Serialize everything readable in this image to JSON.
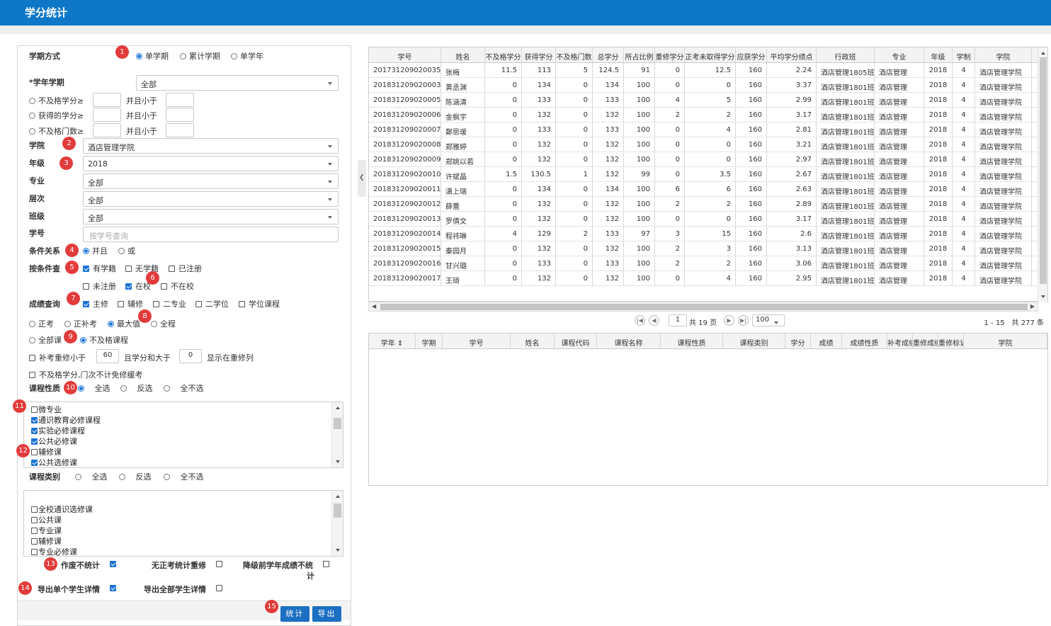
{
  "header": {
    "title": "学分统计"
  },
  "form": {
    "term_mode": {
      "label": "学期方式",
      "options": [
        "单学期",
        "累计学期",
        "单学年"
      ],
      "selected": 0
    },
    "term": {
      "label": "*学年学期",
      "value": "全部"
    },
    "fail_credit": {
      "label": "不及格学分≥",
      "and_less": "并且小于"
    },
    "earned_credit": {
      "label": "获得的学分≥",
      "and_less": "并且小于"
    },
    "fail_courses": {
      "label": "不及格门数≥",
      "and_less": "并且小于"
    },
    "college": {
      "label": "学院",
      "value": "酒店管理学院"
    },
    "grade": {
      "label": "年级",
      "value": "2018"
    },
    "major": {
      "label": "专业",
      "value": "全部"
    },
    "level": {
      "label": "层次",
      "value": "全部"
    },
    "class": {
      "label": "班级",
      "value": "全部"
    },
    "student_id": {
      "label": "学号",
      "placeholder": "按学号查询"
    },
    "condition": {
      "label": "条件关系",
      "options": [
        "并且",
        "或"
      ],
      "selected": 0
    },
    "filter": {
      "label": "按条件查",
      "options": [
        "有学籍",
        "无学籍",
        "已注册",
        "未注册",
        "在校",
        "不在校"
      ]
    },
    "score_query": {
      "label": "成绩查询",
      "options": [
        "主修",
        "辅修",
        "二专业",
        "二学位",
        "学位课程"
      ]
    },
    "exam_types": [
      "正考",
      "正补考",
      "最大值",
      "全程"
    ],
    "course_scope": [
      "全部课",
      "不及格课程"
    ],
    "retake": {
      "text1": "补考重修小于",
      "v1": "60",
      "text2": "且学分和大于",
      "v2": "0",
      "text3": "显示在重修列"
    },
    "exclude": "不及格学分,门次不计免修缓考",
    "course_nature": {
      "label": "课程性质",
      "options": [
        "全选",
        "反选",
        "全不选"
      ],
      "items": [
        "微专业",
        "通识教育必修课程",
        "实验必修课程",
        "公共必修课",
        "辅修课",
        "公共选修课"
      ]
    },
    "course_category": {
      "label": "课程类别",
      "options": [
        "全选",
        "反选",
        "全不选"
      ],
      "items": [
        "全校通识选修课",
        "公共课",
        "专业课",
        "辅修课",
        "专业必修课"
      ]
    },
    "opts": {
      "void_label": "作废不统计",
      "no_exam_label": "无正考统计重修",
      "downgrade_label_1": "降级前学年成绩不统",
      "downgrade_label_2": "计",
      "export_one": "导出单个学生详情",
      "export_all": "导出全部学生详情"
    },
    "buttons": {
      "stat": "统计",
      "export": "导出"
    }
  },
  "badges": [
    "1",
    "2",
    "3",
    "4",
    "5",
    "6",
    "7",
    "8",
    "9",
    "10",
    "11",
    "12",
    "13",
    "14",
    "15"
  ],
  "grid": {
    "columns": [
      "学号",
      "姓名",
      "不及格学分",
      "获得学分",
      "不及格门数",
      "总学分",
      "所占比例",
      "重修学分",
      "正考未取得学分",
      "应获学分",
      "平均学分绩点",
      "行政班",
      "专业",
      "年级",
      "学制",
      "学院"
    ],
    "rows": [
      [
        "201731209020035",
        "张梅",
        "11.5",
        "113",
        "5",
        "124.5",
        "91",
        "0",
        "12.5",
        "160",
        "2.24",
        "酒店管理1805班",
        "酒店管理",
        "2018",
        "4",
        "酒店管理学院"
      ],
      [
        "201831209020003",
        "黄丞渊",
        "0",
        "134",
        "0",
        "134",
        "100",
        "0",
        "0",
        "160",
        "3.37",
        "酒店管理1801班",
        "酒店管理",
        "2018",
        "4",
        "酒店管理学院"
      ],
      [
        "201831209020005",
        "陈涵清",
        "0",
        "133",
        "0",
        "133",
        "100",
        "4",
        "5",
        "160",
        "2.99",
        "酒店管理1801班",
        "酒店管理",
        "2018",
        "4",
        "酒店管理学院"
      ],
      [
        "201831209020006",
        "金枫宇",
        "0",
        "132",
        "0",
        "132",
        "100",
        "2",
        "2",
        "160",
        "3.17",
        "酒店管理1801班",
        "酒店管理",
        "2018",
        "4",
        "酒店管理学院"
      ],
      [
        "201831209020007",
        "鄭思瑗",
        "0",
        "133",
        "0",
        "133",
        "100",
        "0",
        "4",
        "160",
        "2.81",
        "酒店管理1801班",
        "酒店管理",
        "2018",
        "4",
        "酒店管理学院"
      ],
      [
        "201831209020008",
        "郑雅婷",
        "0",
        "132",
        "0",
        "132",
        "100",
        "0",
        "0",
        "160",
        "3.21",
        "酒店管理1801班",
        "酒店管理",
        "2018",
        "4",
        "酒店管理学院"
      ],
      [
        "201831209020009",
        "郑姚以若",
        "0",
        "132",
        "0",
        "132",
        "100",
        "0",
        "0",
        "160",
        "2.97",
        "酒店管理1801班",
        "酒店管理",
        "2018",
        "4",
        "酒店管理学院"
      ],
      [
        "201831209020010",
        "许斌晶",
        "1.5",
        "130.5",
        "1",
        "132",
        "99",
        "0",
        "3.5",
        "160",
        "2.67",
        "酒店管理1801班",
        "酒店管理",
        "2018",
        "4",
        "酒店管理学院"
      ],
      [
        "201831209020011",
        "潇上瑞",
        "0",
        "134",
        "0",
        "134",
        "100",
        "6",
        "6",
        "160",
        "2.63",
        "酒店管理1801班",
        "酒店管理",
        "2018",
        "4",
        "酒店管理学院"
      ],
      [
        "201831209020012",
        "薛蕾",
        "0",
        "132",
        "0",
        "132",
        "100",
        "2",
        "2",
        "160",
        "2.89",
        "酒店管理1801班",
        "酒店管理",
        "2018",
        "4",
        "酒店管理学院"
      ],
      [
        "201831209020013",
        "罗倩文",
        "0",
        "132",
        "0",
        "132",
        "100",
        "0",
        "0",
        "160",
        "3.17",
        "酒店管理1801班",
        "酒店管理",
        "2018",
        "4",
        "酒店管理学院"
      ],
      [
        "201831209020014",
        "程祎琳",
        "4",
        "129",
        "2",
        "133",
        "97",
        "3",
        "15",
        "160",
        "2.6",
        "酒店管理1801班",
        "酒店管理",
        "2018",
        "4",
        "酒店管理学院"
      ],
      [
        "201831209020015",
        "秦园月",
        "0",
        "132",
        "0",
        "132",
        "100",
        "2",
        "3",
        "160",
        "3.13",
        "酒店管理1801班",
        "酒店管理",
        "2018",
        "4",
        "酒店管理学院"
      ],
      [
        "201831209020016",
        "甘兴璐",
        "0",
        "133",
        "0",
        "133",
        "100",
        "2",
        "2",
        "160",
        "3.06",
        "酒店管理1801班",
        "酒店管理",
        "2018",
        "4",
        "酒店管理学院"
      ],
      [
        "201831209020017",
        "王琦",
        "0",
        "132",
        "0",
        "132",
        "100",
        "0",
        "4",
        "160",
        "2.95",
        "酒店管理1801班",
        "酒店管理",
        "2018",
        "4",
        "酒店管理学院"
      ]
    ]
  },
  "pager": {
    "page": "1",
    "of": "共 19 页",
    "size": "100",
    "summary": "1 - 15　共 277 条"
  },
  "grid2": {
    "columns": [
      "学年",
      "学期",
      "学号",
      "姓名",
      "课程代码",
      "课程名称",
      "课程性质",
      "课程类别",
      "学分",
      "成绩",
      "成绩性质",
      "补考成绩",
      "重修成绩",
      "重修标记",
      "学院"
    ]
  }
}
